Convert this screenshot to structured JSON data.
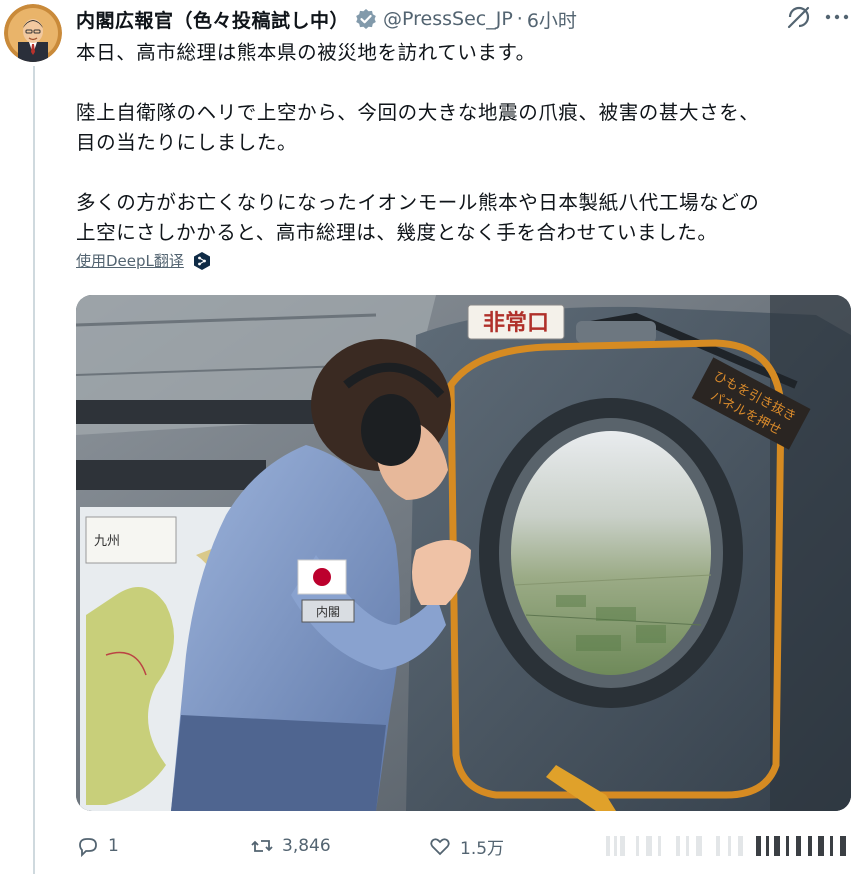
{
  "tweet": {
    "display_name": "内閣広報官（色々投稿試し中）",
    "handle": "@PressSec_JP",
    "separator": "·",
    "time": "6小时",
    "text_lines": [
      "本日、高市総理は熊本県の被災地を訪れています。",
      "陸上自衛隊のヘリで上空から、今回の大きな地震の爪痕、被害の甚大さを、",
      "目の当たりにしました。",
      "多くの方がお亡くなりになったイオンモール熊本や日本製紙八代工場などの",
      "上空にさしかかると、高市総理は、幾度となく手を合わせていました。"
    ],
    "translate_label": "使用DeepL翻译"
  },
  "media": {
    "sign_emergency_exit": "非常口",
    "sign_panel_line1": "ひもを引き抜き",
    "sign_panel_line2": "パネルを押せ",
    "badge_text": "内閣",
    "map_label": "九州"
  },
  "actions": {
    "reply_count": "1",
    "retweet_count": "3,846",
    "like_count": "1.5万"
  },
  "colors": {
    "text_primary": "#0f1419",
    "text_secondary": "#536471",
    "verified_badge": "#829aab",
    "thread_line": "#cfd9de",
    "deepl_blue": "#0f2b46"
  },
  "icons": [
    "avatar",
    "verified-badge-icon",
    "grok-icon",
    "more-icon",
    "deepl-icon",
    "reply-icon",
    "retweet-icon",
    "like-icon"
  ]
}
